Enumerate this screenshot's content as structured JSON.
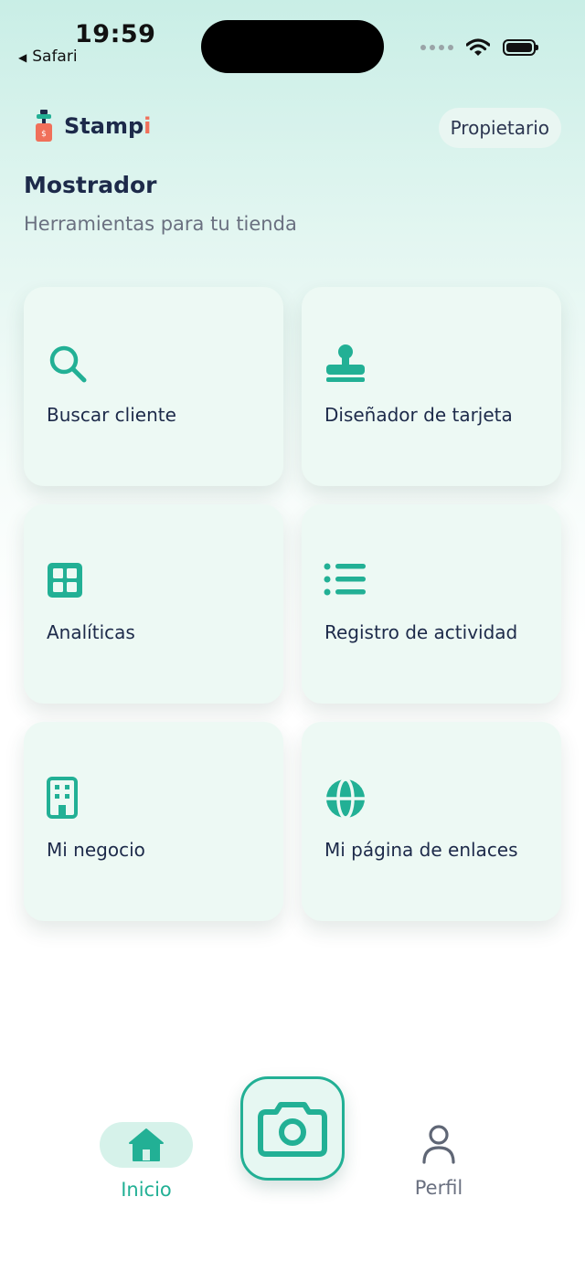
{
  "status_bar": {
    "time": "19:59",
    "back_app": "Safari"
  },
  "brand": {
    "name_main": "Stamp",
    "name_accent": "i"
  },
  "header": {
    "role": "Propietario"
  },
  "page": {
    "title": "Mostrador",
    "subtitle": "Herramientas para tu tienda"
  },
  "tools": [
    {
      "label": "Buscar cliente",
      "icon": "search-icon"
    },
    {
      "label": "Diseñador de tarjeta",
      "icon": "stamp-icon"
    },
    {
      "label": "Analíticas",
      "icon": "grid-icon"
    },
    {
      "label": "Registro de actividad",
      "icon": "list-icon"
    },
    {
      "label": "Mi negocio",
      "icon": "building-icon"
    },
    {
      "label": "Mi página de enlaces",
      "icon": "globe-icon"
    }
  ],
  "nav": {
    "home": "Inicio",
    "profile": "Perfil",
    "camera_icon": "camera-icon"
  },
  "colors": {
    "accent": "#22b095",
    "brand_accent": "#f0705a",
    "card_bg": "#edf9f4",
    "text": "#1d2a4a"
  }
}
